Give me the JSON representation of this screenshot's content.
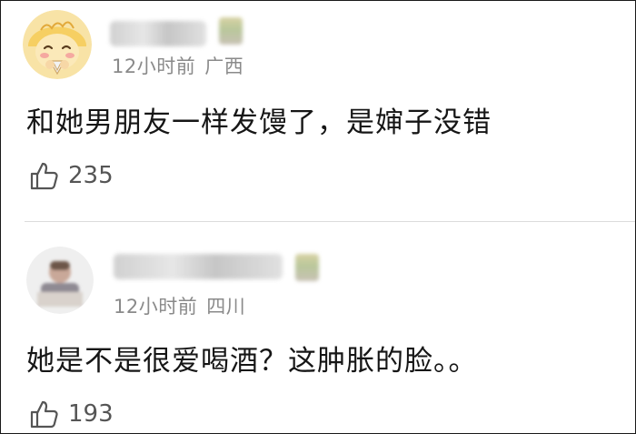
{
  "comments": [
    {
      "time": "12小时前",
      "location": "广西",
      "text": "和她男朋友一样发馒了，是婶子没错",
      "likes": "235",
      "avatar_icon": "cartoon-face-avatar",
      "username_blurred": true
    },
    {
      "time": "12小时前",
      "location": "四川",
      "text": "她是不是很爱喝酒？这肿胀的脸。。",
      "likes": "193",
      "avatar_icon": "blurred-photo-avatar",
      "username_blurred": true
    }
  ],
  "colors": {
    "text": "#161616",
    "meta": "#8a8a8a",
    "likes": "#555555",
    "divider": "#dcdcdc",
    "border": "#1a1a1a"
  },
  "icons": {
    "like": "thumbs-up-icon"
  }
}
